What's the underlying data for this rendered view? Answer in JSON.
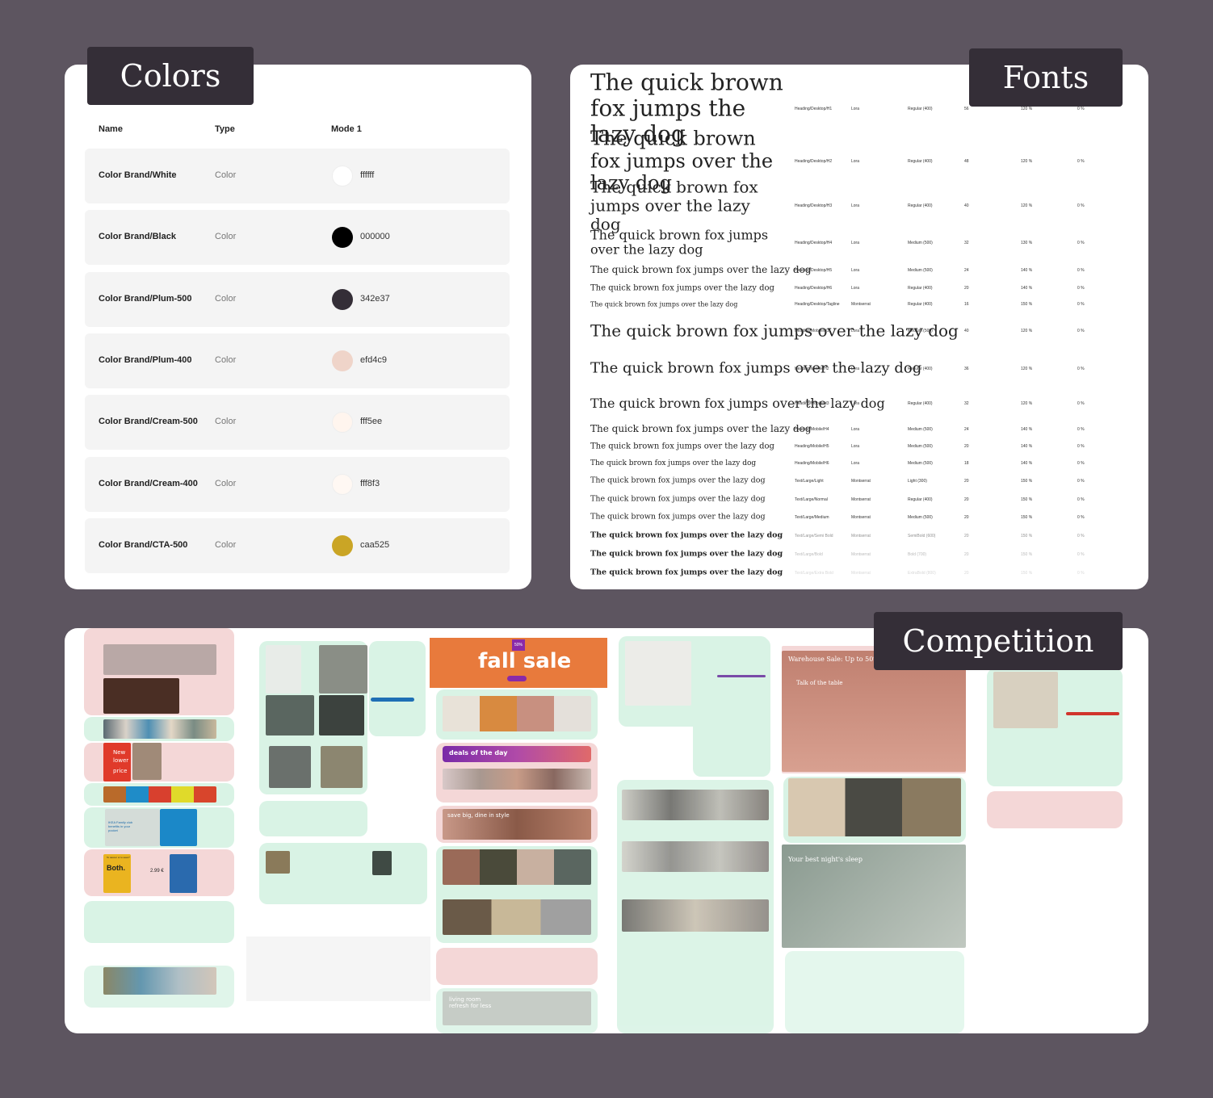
{
  "colors": {
    "title": "Colors",
    "headers": {
      "name": "Name",
      "type": "Type",
      "mode": "Mode 1"
    },
    "rows": [
      {
        "name": "Color Brand/White",
        "type": "Color",
        "hex": "ffffff",
        "swatch": "#ffffff"
      },
      {
        "name": "Color Brand/Black",
        "type": "Color",
        "hex": "000000",
        "swatch": "#000000"
      },
      {
        "name": "Color Brand/Plum-500",
        "type": "Color",
        "hex": "342e37",
        "swatch": "#342e37"
      },
      {
        "name": "Color Brand/Plum-400",
        "type": "Color",
        "hex": "efd4c9",
        "swatch": "#efd4c9"
      },
      {
        "name": "Color Brand/Cream-500",
        "type": "Color",
        "hex": "fff5ee",
        "swatch": "#fff5ee"
      },
      {
        "name": "Color Brand/Cream-400",
        "type": "Color",
        "hex": "fff8f3",
        "swatch": "#fff8f3"
      },
      {
        "name": "Color Brand/CTA-500",
        "type": "Color",
        "hex": "caa525",
        "swatch": "#caa525"
      }
    ]
  },
  "fonts": {
    "title": "Fonts",
    "rows": [
      {
        "sample": "The quick brown fox jumps the lazy dog",
        "style": "Heading/Desktop/H1",
        "family": "Lora",
        "weight": "Regular (400)",
        "size": "56",
        "line_height": "120 %",
        "spacing": "0 %"
      },
      {
        "sample": "The quick brown fox jumps over the lazy dog",
        "style": "Heading/Desktop/H2",
        "family": "Lora",
        "weight": "Regular (400)",
        "size": "48",
        "line_height": "120 %",
        "spacing": "0 %"
      },
      {
        "sample": "The quick brown fox jumps over the lazy dog",
        "style": "Heading/Desktop/H3",
        "family": "Lora",
        "weight": "Regular (400)",
        "size": "40",
        "line_height": "120 %",
        "spacing": "0 %"
      },
      {
        "sample": "The quick brown fox jumps over the lazy dog",
        "style": "Heading/Desktop/H4",
        "family": "Lora",
        "weight": "Medium (500)",
        "size": "32",
        "line_height": "130 %",
        "spacing": "0 %"
      },
      {
        "sample": "The quick brown fox jumps over the lazy dog",
        "style": "Heading/Desktop/H5",
        "family": "Lora",
        "weight": "Medium (500)",
        "size": "24",
        "line_height": "140 %",
        "spacing": "0 %"
      },
      {
        "sample": "The quick brown fox jumps over the lazy dog",
        "style": "Heading/Desktop/H6",
        "family": "Lora",
        "weight": "Regular (400)",
        "size": "20",
        "line_height": "140 %",
        "spacing": "0 %"
      },
      {
        "sample": "The quick brown fox jumps over the lazy dog",
        "style": "Heading/Desktop/Tagline",
        "family": "Montserrat",
        "weight": "Regular (400)",
        "size": "16",
        "line_height": "150 %",
        "spacing": "0 %"
      },
      {
        "sample": "The quick brown fox jumps over the lazy dog",
        "style": "Heading/Mobile/H1",
        "family": "Lora",
        "weight": "Medium (500)",
        "size": "40",
        "line_height": "120 %",
        "spacing": "0 %"
      },
      {
        "sample": "The quick brown fox jumps over the lazy dog",
        "style": "Heading/Mobile/H2",
        "family": "Lora",
        "weight": "Regular (400)",
        "size": "36",
        "line_height": "120 %",
        "spacing": "0 %"
      },
      {
        "sample": "The quick brown fox jumps over the lazy dog",
        "style": "Heading/Mobile/H3",
        "family": "Lora",
        "weight": "Regular (400)",
        "size": "32",
        "line_height": "120 %",
        "spacing": "0 %"
      },
      {
        "sample": "The quick brown fox jumps over the lazy dog",
        "style": "Heading/Mobile/H4",
        "family": "Lora",
        "weight": "Medium (500)",
        "size": "24",
        "line_height": "140 %",
        "spacing": "0 %"
      },
      {
        "sample": "The quick brown fox jumps over the lazy dog",
        "style": "Heading/Mobile/H5",
        "family": "Lora",
        "weight": "Medium (500)",
        "size": "20",
        "line_height": "140 %",
        "spacing": "0 %"
      },
      {
        "sample": "The quick brown fox jumps over the lazy dog",
        "style": "Heading/Mobile/H6",
        "family": "Lora",
        "weight": "Medium (500)",
        "size": "18",
        "line_height": "140 %",
        "spacing": "0 %"
      },
      {
        "sample": "The quick brown fox jumps over the lazy dog",
        "style": "Text/Large/Light",
        "family": "Montserrat",
        "weight": "Light (300)",
        "size": "20",
        "line_height": "150 %",
        "spacing": "0 %"
      },
      {
        "sample": "The quick brown fox jumps over the lazy dog",
        "style": "Text/Large/Normal",
        "family": "Montserrat",
        "weight": "Regular (400)",
        "size": "20",
        "line_height": "150 %",
        "spacing": "0 %"
      },
      {
        "sample": "The quick brown fox jumps over the lazy dog",
        "style": "Text/Large/Medium",
        "family": "Montserrat",
        "weight": "Medium (500)",
        "size": "20",
        "line_height": "150 %",
        "spacing": "0 %"
      },
      {
        "sample": "The quick brown fox jumps over the lazy dog",
        "style": "Text/Large/Semi Bold",
        "family": "Montserrat",
        "weight": "SemiBold (600)",
        "size": "20",
        "line_height": "150 %",
        "spacing": "0 %"
      },
      {
        "sample": "The quick brown fox jumps over the lazy dog",
        "style": "Text/Large/Bold",
        "family": "Montserrat",
        "weight": "Bold (700)",
        "size": "20",
        "line_height": "150 %",
        "spacing": "0 %"
      },
      {
        "sample": "The quick brown fox jumps over the lazy dog",
        "style": "Text/Large/Extra Bold",
        "family": "Montserrat",
        "weight": "ExtraBold (800)",
        "size": "20",
        "line_height": "150 %",
        "spacing": "0 %"
      }
    ]
  },
  "competition": {
    "title": "Competition",
    "banners": {
      "new": "New",
      "lower": "lower",
      "price": "price",
      "club": "IKEA Family club benefits in your pocket",
      "both_q": "To savour or to save?",
      "both": "Both.",
      "both_price": "2.99 €",
      "fall_pct": "50%",
      "fall_sale": "fall sale",
      "deals": "deals of the day",
      "dine": "save big, dine in style",
      "living": "living room refresh for less",
      "warehouse": "Warehouse Sale: Up to 50%",
      "table": "Talk of the table",
      "sleep": "Your best night's sleep"
    }
  }
}
